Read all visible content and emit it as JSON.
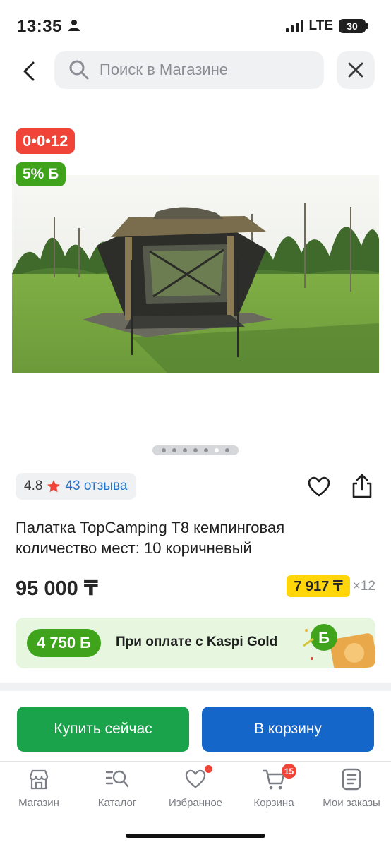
{
  "status_bar": {
    "time": "13:35",
    "network": "LTE",
    "battery": "30"
  },
  "search": {
    "placeholder": "Поиск в Магазине"
  },
  "gallery": {
    "timer_badge": "0•0•12",
    "bonus_badge": "5% Б",
    "photo_icon": "tent-photo",
    "dots_count": 7,
    "active_dot": 6
  },
  "rating": {
    "value": "4.8",
    "reviews": "43 отзыва"
  },
  "product": {
    "title": "Палатка TopCamping T8 кемпинговая количество мест: 10 коричневый",
    "price": "95 000 ₸",
    "installment_amount": "7 917 ₸",
    "installment_months": "×12"
  },
  "kaspi_gold": {
    "bonus": "4 750 Б",
    "text": "При оплате с Kaspi Gold"
  },
  "actions": {
    "buy_now": "Купить сейчас",
    "add_to_cart": "В корзину"
  },
  "tabbar": {
    "items": [
      {
        "label": "Магазин",
        "icon": "store-icon"
      },
      {
        "label": "Каталог",
        "icon": "catalog-search-icon"
      },
      {
        "label": "Избранное",
        "icon": "heart-icon"
      },
      {
        "label": "Корзина",
        "icon": "cart-icon",
        "badge": "15"
      },
      {
        "label": "Мои заказы",
        "icon": "orders-icon"
      }
    ]
  },
  "colors": {
    "accent_red": "#f04438",
    "kaspi_green": "#3fa31b",
    "buy_green": "#1aa34a",
    "cart_blue": "#1467c9",
    "installment_yellow": "#ffd60a",
    "link_blue": "#1f73c9"
  }
}
